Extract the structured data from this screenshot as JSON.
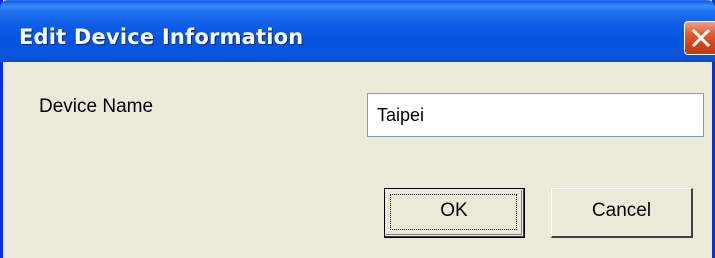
{
  "dialog": {
    "title": "Edit Device Information",
    "close_icon": "close-icon"
  },
  "form": {
    "device_name_label": "Device Name",
    "device_name_value": "Taipei"
  },
  "buttons": {
    "ok_label": "OK",
    "cancel_label": "Cancel"
  },
  "colors": {
    "titlebar": "#0653de",
    "window_bg": "#ece9d8",
    "close_button": "#d4421c",
    "input_border": "#7f9db9"
  }
}
